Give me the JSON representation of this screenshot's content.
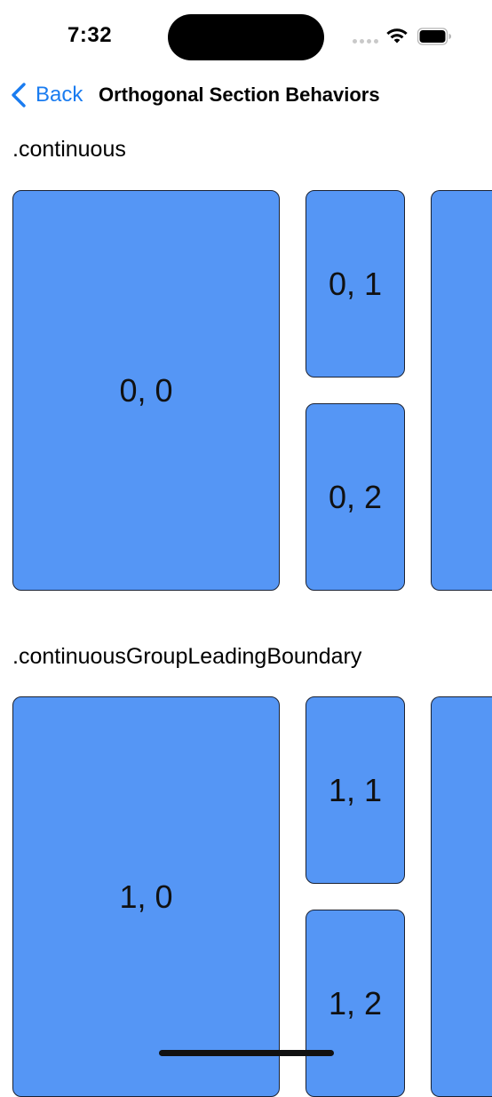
{
  "status_bar": {
    "time": "7:32"
  },
  "nav": {
    "back_label": "Back",
    "title": "Orthogonal Section Behaviors"
  },
  "sections": [
    {
      "header": ".continuous",
      "cells": [
        "0, 0",
        "0, 1",
        "0, 2",
        ""
      ]
    },
    {
      "header": ".continuousGroupLeadingBoundary",
      "cells": [
        "1, 0",
        "1, 1",
        "1, 2",
        ""
      ]
    }
  ],
  "colors": {
    "cell_fill": "#5596f5",
    "accent": "#1a7cf0"
  },
  "icons": [
    "wifi-icon",
    "battery-icon",
    "chevron-left-icon"
  ]
}
